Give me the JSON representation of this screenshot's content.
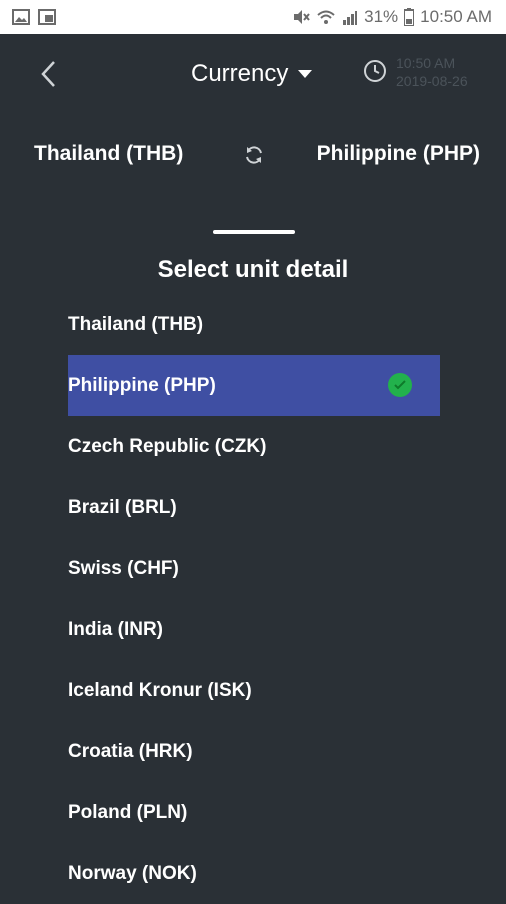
{
  "status_bar": {
    "battery": "31%",
    "time": "10:50 AM"
  },
  "header": {
    "title": "Currency",
    "timestamp_time": "10:50 AM",
    "timestamp_date": "2019-08-26"
  },
  "converter": {
    "from": "Thailand (THB)",
    "to": "Philippine (PHP)"
  },
  "sheet": {
    "title": "Select unit detail",
    "items": [
      {
        "label": "Thailand (THB)"
      },
      {
        "label": "Philippine (PHP)"
      },
      {
        "label": "Czech Republic (CZK)"
      },
      {
        "label": "Brazil (BRL)"
      },
      {
        "label": "Swiss (CHF)"
      },
      {
        "label": "India (INR)"
      },
      {
        "label": "Iceland Kronur (ISK)"
      },
      {
        "label": "Croatia (HRK)"
      },
      {
        "label": "Poland (PLN)"
      },
      {
        "label": "Norway (NOK)"
      }
    ],
    "selected_index": 1
  },
  "colors": {
    "background": "#2a3036",
    "selected": "#3f4fa3",
    "check": "#22b14c"
  },
  "icons": {
    "back": "chevron-left-icon",
    "dropdown": "caret-down-icon",
    "history": "history-clock-icon",
    "swap": "refresh-icon",
    "check": "check-circle-icon"
  }
}
